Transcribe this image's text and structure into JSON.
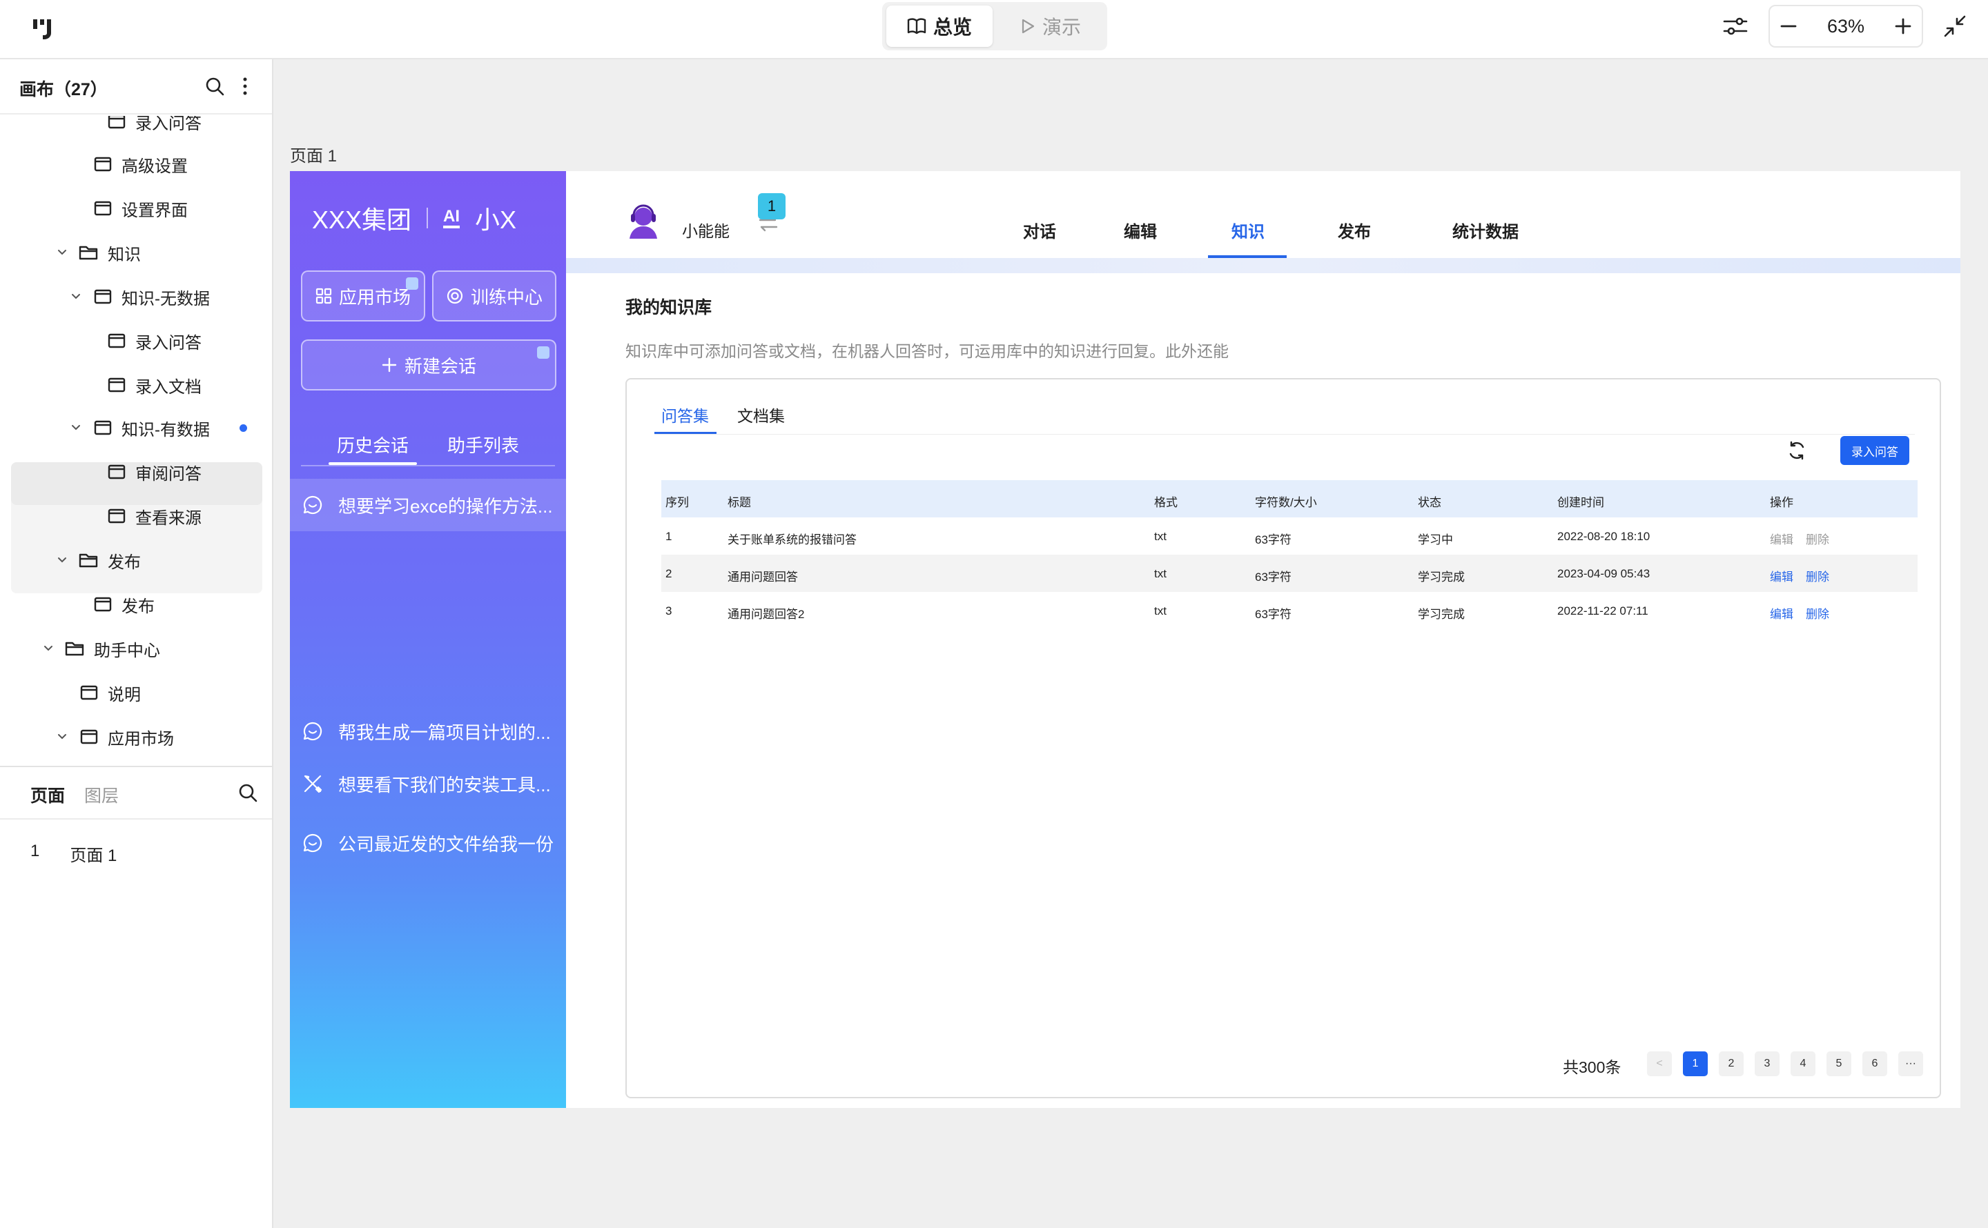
{
  "toolbar": {
    "mode_overview": "总览",
    "mode_present": "演示",
    "zoom": "63%"
  },
  "left_panel": {
    "title": "画布（27）",
    "tree": [
      {
        "label": "录入问答"
      },
      {
        "label": "高级设置"
      },
      {
        "label": "设置界面"
      },
      {
        "label": "知识"
      },
      {
        "label": "知识-无数据"
      },
      {
        "label": "录入问答"
      },
      {
        "label": "录入文档"
      },
      {
        "label": "知识-有数据"
      },
      {
        "label": "审阅问答"
      },
      {
        "label": "查看来源"
      },
      {
        "label": "发布"
      },
      {
        "label": "发布"
      },
      {
        "label": "助手中心"
      },
      {
        "label": "说明"
      },
      {
        "label": "应用市场"
      }
    ],
    "tabs": {
      "pages": "页面",
      "layers": "图层"
    },
    "pages": [
      {
        "index": "1",
        "name": "页面 1"
      }
    ]
  },
  "canvas": {
    "page_label": "页面 1"
  },
  "app": {
    "brand": {
      "company": "XXX集团",
      "ai_name": "小X",
      "ai_badge": "AI"
    },
    "buttons": {
      "market": "应用市场",
      "training": "训练中心",
      "new_chat": "新建会话"
    },
    "side_tabs": {
      "history": "历史会话",
      "assistants": "助手列表"
    },
    "history": [
      "想要学习exce的操作方法...",
      "帮我生成一篇项目计划的...",
      "想要看下我们的安装工具...",
      "公司最近发的文件给我一份"
    ],
    "assistant_name": "小能能",
    "assistant_badge": "1",
    "nav_tabs": [
      "对话",
      "编辑",
      "知识",
      "发布",
      "统计数据"
    ],
    "kb": {
      "title": "我的知识库",
      "desc": "知识库中可添加问答或文档，在机器人回答时，可运用库中的知识进行回复。此外还能",
      "sub_tabs": [
        "问答集",
        "文档集"
      ],
      "add_button": "录入问答",
      "columns": [
        "序列",
        "标题",
        "格式",
        "字符数/大小",
        "状态",
        "创建时间",
        "操作"
      ],
      "rows": [
        {
          "no": "1",
          "title": "关于账单系统的报错问答",
          "format": "txt",
          "size": "63字符",
          "status": "学习中",
          "created": "2022-08-20 18:10",
          "edit": "编辑",
          "delete": "删除"
        },
        {
          "no": "2",
          "title": "通用问题回答",
          "format": "txt",
          "size": "63字符",
          "status": "学习完成",
          "created": "2023-04-09 05:43",
          "edit": "编辑",
          "delete": "删除"
        },
        {
          "no": "3",
          "title": "通用问题回答2",
          "format": "txt",
          "size": "63字符",
          "status": "学习完成",
          "created": "2022-11-22 07:11",
          "edit": "编辑",
          "delete": "删除"
        }
      ],
      "total": "共300条",
      "pages": [
        "1",
        "2",
        "3",
        "4",
        "5",
        "6",
        "···"
      ],
      "prev": "<"
    }
  },
  "colors": {
    "accent": "#2766e8",
    "primary_button": "#1f63f0",
    "sidebar_top": "#7b5cf5",
    "sidebar_bottom": "#44c6fb"
  }
}
